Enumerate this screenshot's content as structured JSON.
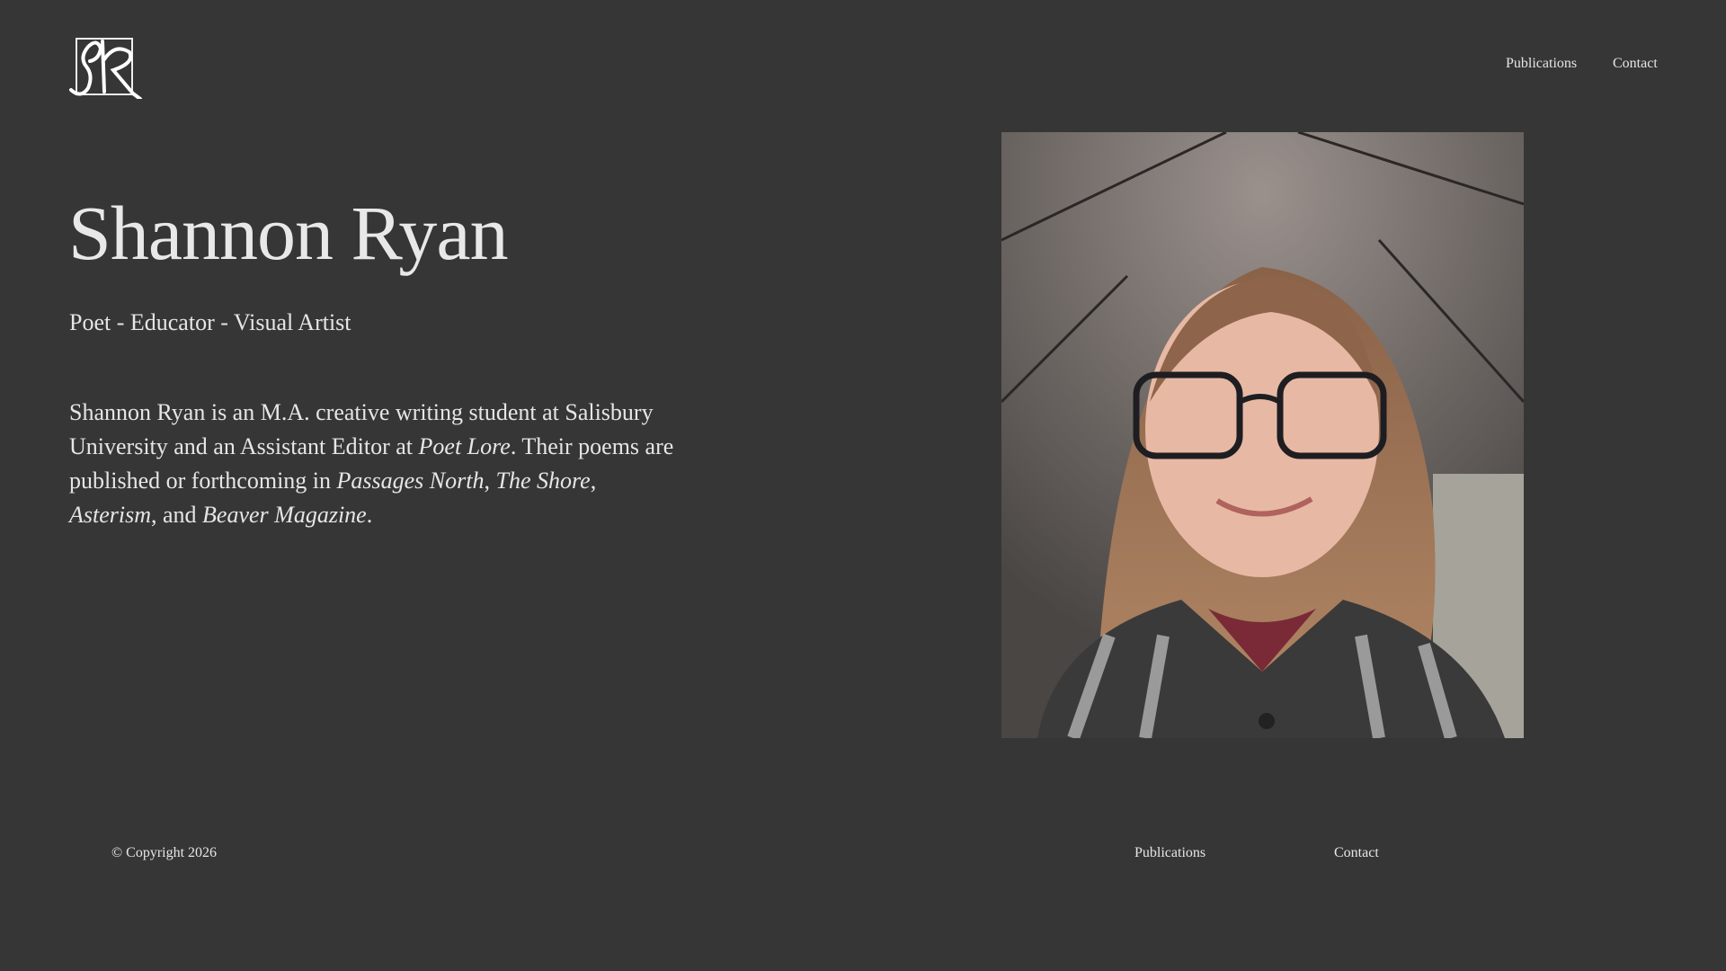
{
  "header": {
    "logo_text": "SR",
    "nav": [
      {
        "label": "Publications"
      },
      {
        "label": "Contact"
      }
    ]
  },
  "hero": {
    "title": "Shannon Ryan",
    "subtitle": "Poet - Educator - Visual Artist",
    "bio": [
      {
        "text": "Shannon Ryan is an M.A. creative writing student at Salisbury University and an Assistant Editor at ",
        "italic": false
      },
      {
        "text": "Poet Lore",
        "italic": true
      },
      {
        "text": ". Their poems are published or forthcoming in ",
        "italic": false
      },
      {
        "text": "Passages North",
        "italic": true
      },
      {
        "text": ", ",
        "italic": false
      },
      {
        "text": "The Shore",
        "italic": true
      },
      {
        "text": ", ",
        "italic": false
      },
      {
        "text": "Asterism",
        "italic": true
      },
      {
        "text": ", and ",
        "italic": false
      },
      {
        "text": "Beaver Magazine",
        "italic": true
      },
      {
        "text": ".",
        "italic": false
      }
    ]
  },
  "footer": {
    "copyright": "© Copyright 2026",
    "links": [
      {
        "label": "Publications"
      },
      {
        "label": "Contact"
      }
    ]
  }
}
